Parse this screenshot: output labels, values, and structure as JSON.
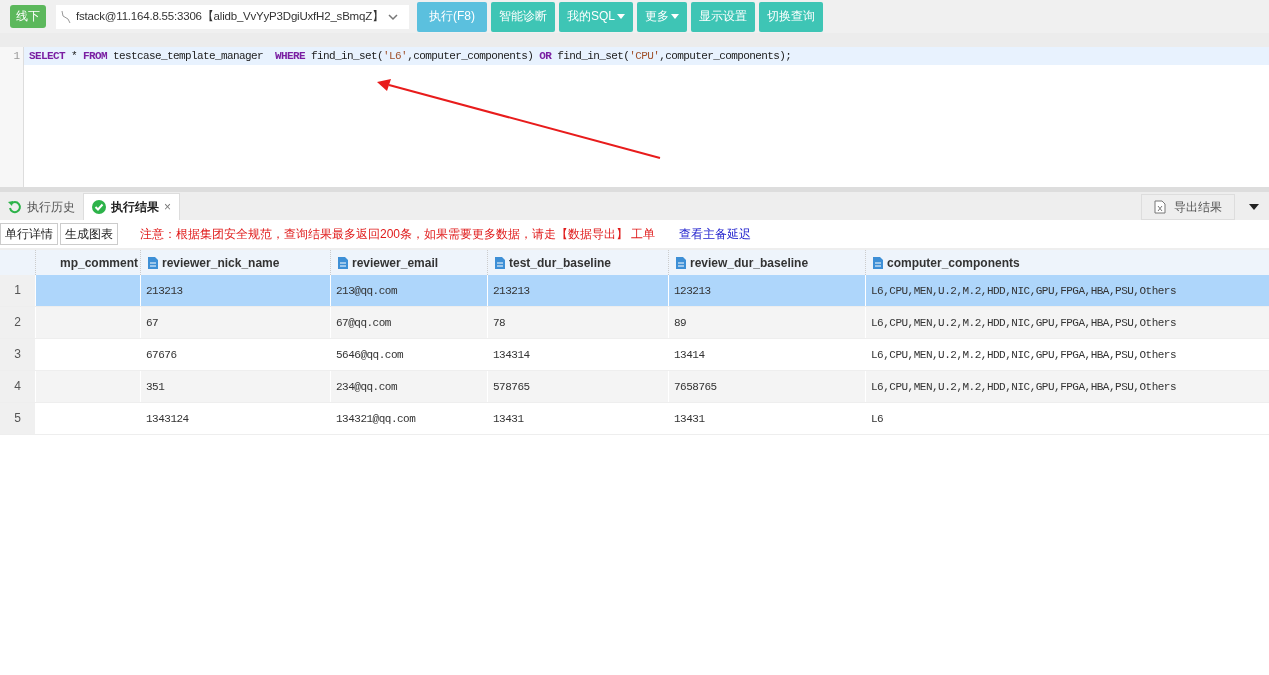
{
  "toolbar": {
    "env_badge": "线下",
    "connection": "fstack@11.164.8.55:3306【alidb_VvYyP3DgiUxfH2_sBmqZ】",
    "buttons": [
      {
        "label": "执行(F8)",
        "kind": "primary",
        "caret": false
      },
      {
        "label": "智能诊断",
        "kind": "normal",
        "caret": false
      },
      {
        "label": "我的SQL",
        "kind": "normal",
        "caret": true
      },
      {
        "label": "更多",
        "kind": "normal",
        "caret": true
      },
      {
        "label": "显示设置",
        "kind": "normal",
        "caret": false
      },
      {
        "label": "切换查询",
        "kind": "normal",
        "caret": false
      }
    ]
  },
  "editor": {
    "lines": [
      {
        "number": "1",
        "tokens": [
          {
            "text": "SELECT",
            "kind": "keyword"
          },
          {
            "text": " * ",
            "kind": "plain"
          },
          {
            "text": "FROM",
            "kind": "keyword"
          },
          {
            "text": " testcase_template_manager  ",
            "kind": "plain"
          },
          {
            "text": "WHERE",
            "kind": "keyword"
          },
          {
            "text": " find_in_set(",
            "kind": "plain"
          },
          {
            "text": "'L6'",
            "kind": "string"
          },
          {
            "text": ",computer_components) ",
            "kind": "plain"
          },
          {
            "text": "OR",
            "kind": "keyword"
          },
          {
            "text": " find_in_set(",
            "kind": "plain"
          },
          {
            "text": "'CPU'",
            "kind": "string"
          },
          {
            "text": ",computer_components);",
            "kind": "plain"
          }
        ]
      }
    ]
  },
  "result_tabs": [
    {
      "label": "执行历史",
      "selected": false,
      "closable": false
    },
    {
      "label": "执行结果",
      "selected": true,
      "closable": true
    }
  ],
  "close_symbol": "×",
  "export_button": "导出结果",
  "actions": [
    "单行详情",
    "生成图表"
  ],
  "notice": "注意：根据集团安全规范，查询结果最多返回200条，如果需要更多数据，请走【数据导出】 工单",
  "link": "查看主备延迟",
  "table": {
    "columns": [
      "mp_comment",
      "reviewer_nick_name",
      "reviewer_email",
      "test_dur_baseline",
      "review_dur_baseline",
      "computer_components"
    ],
    "rows": [
      {
        "number": "1",
        "selected": true,
        "cells": [
          "",
          "213213",
          "213@qq.com",
          "213213",
          "123213",
          "L6,CPU,MEN,U.2,M.2,HDD,NIC,GPU,FPGA,HBA,PSU,Others"
        ]
      },
      {
        "number": "2",
        "selected": false,
        "cells": [
          "",
          "67",
          "67@qq.com",
          "78",
          "89",
          "L6,CPU,MEN,U.2,M.2,HDD,NIC,GPU,FPGA,HBA,PSU,Others"
        ]
      },
      {
        "number": "3",
        "selected": false,
        "cells": [
          "",
          "67676",
          "5646@qq.com",
          "134314",
          "13414",
          "L6,CPU,MEN,U.2,M.2,HDD,NIC,GPU,FPGA,HBA,PSU,Others"
        ]
      },
      {
        "number": "4",
        "selected": false,
        "cells": [
          "",
          "351",
          "234@qq.com",
          "578765",
          "7658765",
          "L6,CPU,MEN,U.2,M.2,HDD,NIC,GPU,FPGA,HBA,PSU,Others"
        ]
      },
      {
        "number": "5",
        "selected": false,
        "cells": [
          "",
          "1343124",
          "134321@qq.com",
          "13431",
          "13431",
          "L6"
        ]
      }
    ]
  }
}
